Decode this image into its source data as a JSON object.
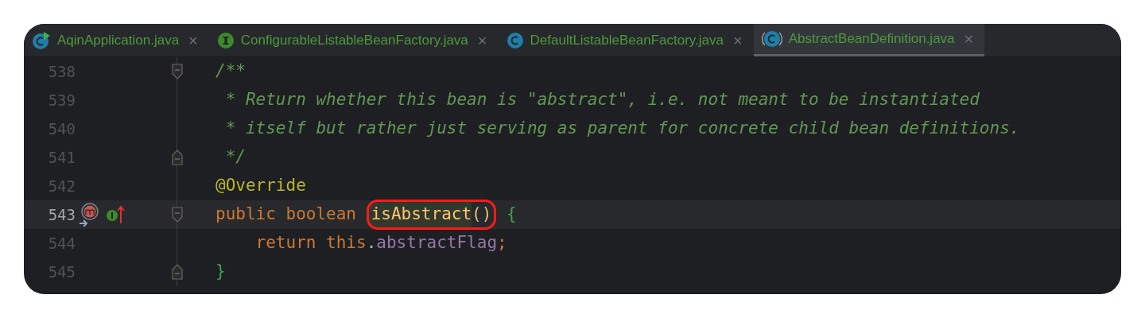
{
  "tabs": [
    {
      "label": "AqinApplication.java",
      "kind": "class-run",
      "selected": false,
      "close": "×"
    },
    {
      "label": "ConfigurableListableBeanFactory.java",
      "kind": "interface",
      "selected": false,
      "close": "×"
    },
    {
      "label": "DefaultListableBeanFactory.java",
      "kind": "class",
      "selected": false,
      "close": "×"
    },
    {
      "label": "AbstractBeanDefinition.java",
      "kind": "abstract-class",
      "selected": true,
      "close": "×"
    }
  ],
  "editor": {
    "lines": [
      {
        "number": "538",
        "fold": {
          "kind": "start"
        },
        "current": false,
        "tokens": [
          {
            "text": "/**",
            "kind": "comment"
          }
        ]
      },
      {
        "number": "539",
        "current": false,
        "tokens": [
          {
            "text": " * Return whether this bean is \"abstract\", i.e. not meant to be instantiated",
            "kind": "comment"
          }
        ]
      },
      {
        "number": "540",
        "current": false,
        "tokens": [
          {
            "text": " * itself but rather just serving as parent for concrete child bean definitions.",
            "kind": "comment"
          }
        ]
      },
      {
        "number": "541",
        "fold": {
          "kind": "end"
        },
        "current": false,
        "tokens": [
          {
            "text": " */",
            "kind": "comment"
          }
        ]
      },
      {
        "number": "542",
        "current": false,
        "tokens": [
          {
            "text": "@Override",
            "kind": "annotation"
          }
        ]
      },
      {
        "number": "543",
        "fold": {
          "kind": "start"
        },
        "current": true,
        "gutter": [
          {
            "kind": "overrides"
          },
          {
            "kind": "implements"
          }
        ],
        "tokens": [
          {
            "text": "public boolean ",
            "kind": "keyword"
          },
          {
            "text": "isAbstract",
            "kind": "method",
            "circled": true
          },
          {
            "text": "()",
            "kind": "paren",
            "circled": true
          },
          {
            "text": " {",
            "kind": "brace"
          }
        ]
      },
      {
        "number": "544",
        "current": false,
        "tokens": [
          {
            "text": "    return this",
            "kind": "keyword"
          },
          {
            "text": ".",
            "kind": "plain"
          },
          {
            "text": "abstractFlag",
            "kind": "field"
          },
          {
            "text": ";",
            "kind": "keyword"
          }
        ]
      },
      {
        "number": "545",
        "fold": {
          "kind": "end"
        },
        "current": false,
        "tokens": [
          {
            "text": "}",
            "kind": "brace"
          }
        ]
      }
    ]
  }
}
